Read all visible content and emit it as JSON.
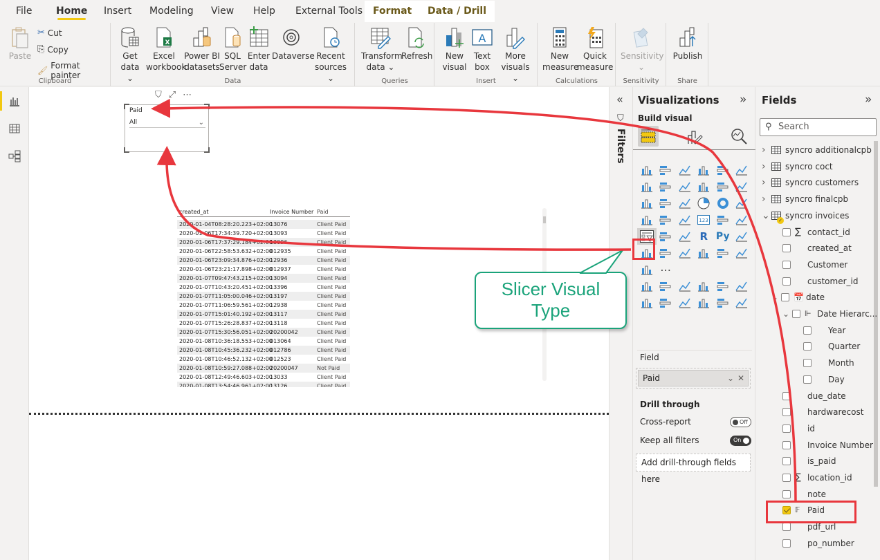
{
  "ribbon_tabs": [
    {
      "label": "File"
    },
    {
      "label": "Home",
      "active": true
    },
    {
      "label": "Insert"
    },
    {
      "label": "Modeling"
    },
    {
      "label": "View"
    },
    {
      "label": "Help"
    },
    {
      "label": "External Tools"
    },
    {
      "label": "Format",
      "contextual": true
    },
    {
      "label": "Data / Drill",
      "contextual": true
    }
  ],
  "ribbon": {
    "clipboard": {
      "label": "Clipboard",
      "paste": "Paste",
      "cut": "Cut",
      "copy": "Copy",
      "format_painter": "Format painter"
    },
    "data": {
      "label": "Data",
      "get_data": [
        "Get",
        "data ⌄"
      ],
      "excel": [
        "Excel",
        "workbook"
      ],
      "pbi_datasets": [
        "Power BI",
        "datasets"
      ],
      "sql": [
        "SQL",
        "Server"
      ],
      "enter_data": [
        "Enter",
        "data"
      ],
      "dataverse": [
        "Dataverse",
        ""
      ],
      "recent": [
        "Recent",
        "sources ⌄"
      ]
    },
    "queries": {
      "label": "Queries",
      "transform": [
        "Transform",
        "data ⌄"
      ],
      "refresh": [
        "Refresh",
        ""
      ]
    },
    "insert": {
      "label": "Insert",
      "new_visual": [
        "New",
        "visual"
      ],
      "text_box": [
        "Text",
        "box"
      ],
      "more_visuals": [
        "More",
        "visuals ⌄"
      ]
    },
    "calculations": {
      "label": "Calculations",
      "new_measure": [
        "New",
        "measure"
      ],
      "quick_measure": [
        "Quick",
        "measure"
      ]
    },
    "sensitivity": {
      "label": "Sensitivity",
      "button": [
        "Sensitivity",
        "⌄"
      ]
    },
    "share": {
      "label": "Share",
      "publish": [
        "Publish",
        ""
      ]
    }
  },
  "left_nav": [
    {
      "name": "report-view",
      "active": true
    },
    {
      "name": "data-view"
    },
    {
      "name": "model-view"
    }
  ],
  "canvas": {
    "slicer": {
      "title": "Paid",
      "selected": "All"
    },
    "table": {
      "headers": [
        "created_at",
        "Invoice Number",
        "Paid"
      ],
      "rows": [
        [
          "2020-01-04T08:28:20.223+02:00",
          "13076",
          "Client Paid"
        ],
        [
          "2020-01-06T17:34:39.720+02:00",
          "13093",
          "Client Paid"
        ],
        [
          "2020-01-06T17:37:29.184+02:00",
          "13096",
          "Client Paid"
        ],
        [
          "2020-01-06T22:58:53.632+02:00",
          "012935",
          "Client Paid"
        ],
        [
          "2020-01-06T23:09:34.876+02:00",
          "12936",
          "Client Paid"
        ],
        [
          "2020-01-06T23:21:17.898+02:00",
          "012937",
          "Client Paid"
        ],
        [
          "2020-01-07T09:47:43.215+02:00",
          "13094",
          "Client Paid"
        ],
        [
          "2020-01-07T10:43:20.451+02:00",
          "13396",
          "Client Paid"
        ],
        [
          "2020-01-07T11:05:00.046+02:00",
          "13197",
          "Client Paid"
        ],
        [
          "2020-01-07T11:06:59.561+02:00",
          "12938",
          "Client Paid"
        ],
        [
          "2020-01-07T15:01:40.192+02:00",
          "13117",
          "Client Paid"
        ],
        [
          "2020-01-07T15:26:28.837+02:00",
          "13118",
          "Client Paid"
        ],
        [
          "2020-01-07T15:30:56.051+02:00",
          "20200042",
          "Client Paid"
        ],
        [
          "2020-01-08T10:36:18.553+02:00",
          "013064",
          "Client Paid"
        ],
        [
          "2020-01-08T10:45:36.232+02:00",
          "012786",
          "Client Paid"
        ],
        [
          "2020-01-08T10:46:52.132+02:00",
          "012523",
          "Client Paid"
        ],
        [
          "2020-01-08T10:59:27.088+02:00",
          "20200047",
          "Not Paid"
        ],
        [
          "2020-01-08T12:49:46.603+02:00",
          "13033",
          "Client Paid"
        ],
        [
          "2020-01-08T13:54:46.961+02:00",
          "13126",
          "Client Paid"
        ]
      ]
    }
  },
  "filters_pane": {
    "label": "Filters"
  },
  "visualizations": {
    "title": "Visualizations",
    "build_visual": "Build visual",
    "field_label": "Field",
    "field_value": "Paid",
    "drill_through": "Drill through",
    "cross_report": "Cross-report",
    "cross_report_state": "Off",
    "keep_filters": "Keep all filters",
    "keep_filters_state": "On",
    "add_drill": "Add drill-through fields here",
    "more": "..."
  },
  "fields": {
    "title": "Fields",
    "search_placeholder": "Search",
    "tables": [
      {
        "label": "syncro additionalcpb"
      },
      {
        "label": "syncro coct"
      },
      {
        "label": "syncro customers"
      },
      {
        "label": "syncro finalcpb"
      },
      {
        "label": "syncro invoices",
        "expanded": true
      }
    ],
    "invoice_fields": [
      {
        "label": "contact_id",
        "sigma": true
      },
      {
        "label": "created_at"
      },
      {
        "label": "Customer"
      },
      {
        "label": "customer_id"
      },
      {
        "label": "date",
        "calendar": true
      },
      {
        "label": "Date Hierarc...",
        "hierarchy": true
      },
      {
        "label": "Year",
        "level": 2
      },
      {
        "label": "Quarter",
        "level": 2
      },
      {
        "label": "Month",
        "level": 2
      },
      {
        "label": "Day",
        "level": 2
      },
      {
        "label": "due_date"
      },
      {
        "label": "hardwarecost"
      },
      {
        "label": "id"
      },
      {
        "label": "Invoice Number"
      },
      {
        "label": "is_paid"
      },
      {
        "label": "location_id",
        "sigma": true
      },
      {
        "label": "note"
      },
      {
        "label": "Paid",
        "checked": true,
        "calc": true
      },
      {
        "label": "pdf_url"
      },
      {
        "label": "po_number"
      }
    ]
  },
  "annotation": {
    "callout_line1": "Slicer Visual",
    "callout_line2": "Type",
    "accent": "#1aa37a",
    "arrow_color": "#e8373d"
  }
}
